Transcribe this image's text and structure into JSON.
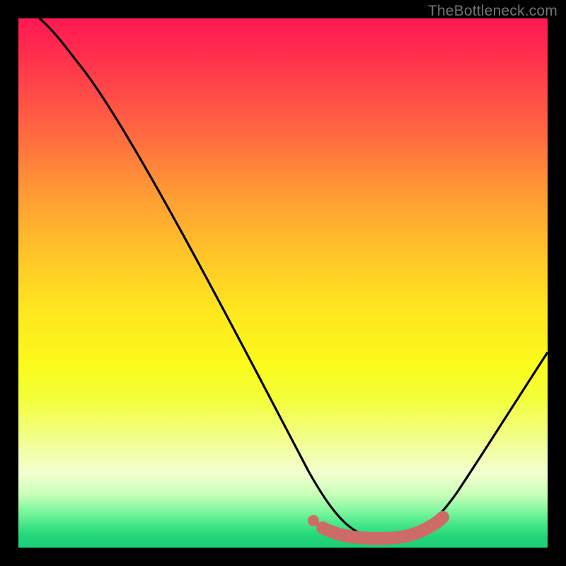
{
  "credit_text": "TheBottleneck.com",
  "colors": {
    "curve": "#000000",
    "highlight": "#cd6b66",
    "frame_bg": "#000000"
  },
  "chart_data": {
    "type": "line",
    "title": "",
    "xlabel": "",
    "ylabel": "",
    "xlim": [
      0,
      100
    ],
    "ylim": [
      0,
      100
    ],
    "grid": false,
    "series": [
      {
        "name": "bottleneck-curve",
        "x": [
          4,
          8,
          12,
          18,
          24,
          30,
          36,
          42,
          48,
          54,
          58,
          62,
          66,
          70,
          74,
          78,
          82,
          86,
          90,
          95,
          100
        ],
        "y": [
          100,
          96,
          92.5,
          87,
          80,
          72,
          63,
          53,
          42,
          30,
          20,
          11,
          5,
          2,
          1.5,
          2,
          4,
          8,
          15,
          25,
          38
        ]
      }
    ],
    "annotations": [
      {
        "name": "valley-highlight",
        "type": "segment",
        "x": [
          58,
          80
        ],
        "y": [
          3,
          3
        ],
        "stroke_width": 14,
        "color": "#cd6b66"
      }
    ]
  }
}
